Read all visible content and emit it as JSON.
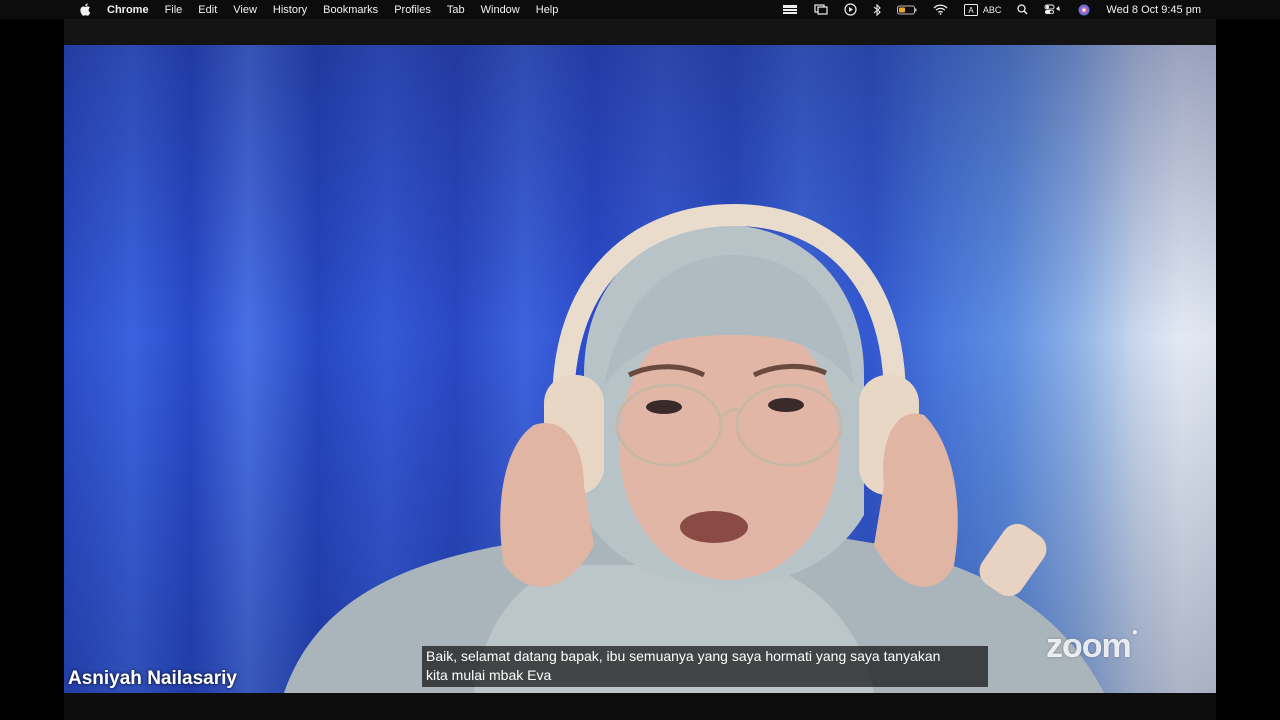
{
  "menubar": {
    "app_name": "Chrome",
    "items": [
      "File",
      "Edit",
      "View",
      "History",
      "Bookmarks",
      "Profiles",
      "Tab",
      "Window",
      "Help"
    ],
    "input_badge": "A",
    "input_source": "ABC",
    "datetime": "Wed 8 Oct  9:45 pm",
    "icons": [
      "stage-manager-icon",
      "screen-mirroring-icon",
      "play-icon",
      "bluetooth-icon",
      "battery-icon",
      "wifi-icon",
      "input-source-icon",
      "search-icon",
      "control-center-icon",
      "siri-icon"
    ]
  },
  "video": {
    "participant_name": "Asniyah Nailasariy",
    "caption_lines": [
      "Baik, selamat datang bapak, ibu semuanya yang saya hormati yang saya tanyakan",
      "kita mulai mbak Eva"
    ],
    "watermark": "zoom"
  }
}
